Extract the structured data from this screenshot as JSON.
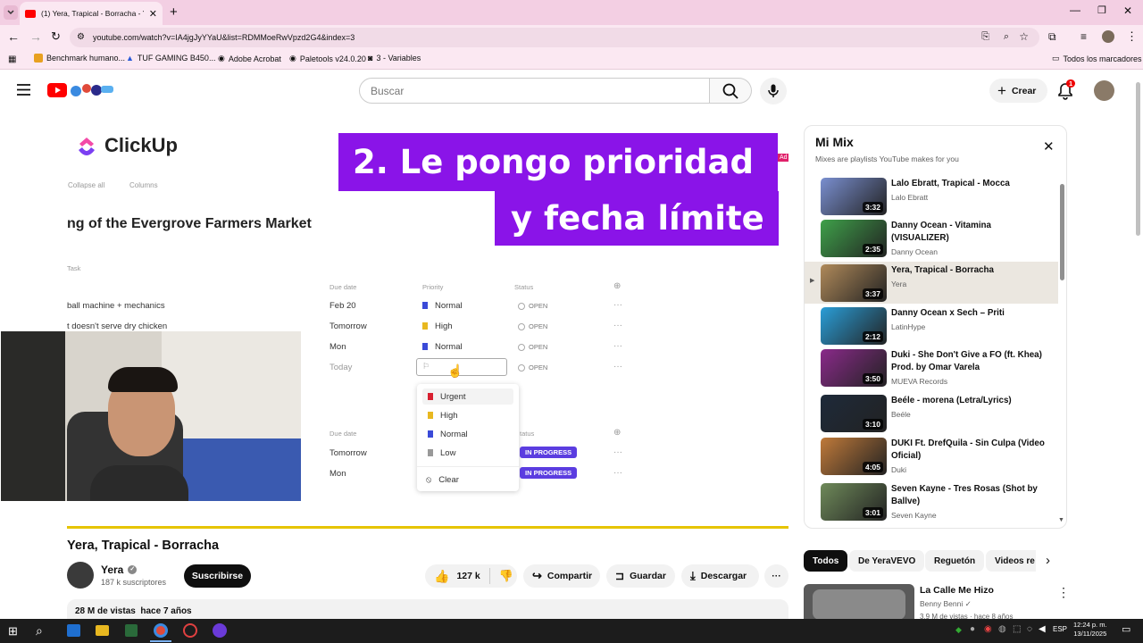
{
  "browser": {
    "tab_title": "(1) Yera, Trapical - Borracha - Yo",
    "url": "youtube.com/watch?v=IA4jgJyYYaU&list=RDMMoeRwVpzd2G4&index=3",
    "bookmarks": [
      "Benchmark humano...",
      "TUF GAMING B450...",
      "Adobe Acrobat",
      "Paletools v24.0.20",
      "3 - Variables"
    ],
    "all_bookmarks": "Todos los marcadores"
  },
  "yt": {
    "search_placeholder": "Buscar",
    "create_label": "Crear",
    "notif_count": "1"
  },
  "video_overlay": {
    "caption_line1": "2. Le pongo prioridad",
    "caption_line2": "y fecha límite",
    "clickup_logo": "ClickUp",
    "toolbar": [
      "Collapse all",
      "Columns"
    ],
    "project_title": "ng of the Evergrove Farmers Market",
    "task_header": "Task",
    "columns": [
      "Due date",
      "Priority",
      "Status"
    ],
    "tasks": [
      {
        "name": "ball machine + mechanics",
        "due": "Feb 20",
        "priority": "Normal",
        "status": "OPEN"
      },
      {
        "name": "t doesn't serve dry chicken",
        "due": "Tomorrow",
        "priority": "High",
        "status": "OPEN"
      },
      {
        "name": "",
        "due": "Mon",
        "priority": "Normal",
        "status": "OPEN"
      },
      {
        "name": "",
        "due": "Today",
        "priority": "",
        "status": "OPEN"
      }
    ],
    "priority_menu": [
      "Urgent",
      "High",
      "Normal",
      "Low",
      "Clear"
    ],
    "group2_columns": [
      "Due date",
      "tatus"
    ],
    "group2": [
      {
        "due": "Tomorrow",
        "status": "IN PROGRESS"
      },
      {
        "due": "Mon",
        "status": "IN PROGRESS"
      }
    ],
    "ad_badge": "Ad"
  },
  "video": {
    "title": "Yera, Trapical - Borracha",
    "channel": "Yera",
    "subscribers": "187 k suscriptores",
    "subscribe_label": "Suscribirse",
    "likes": "127 k",
    "share_label": "Compartir",
    "save_label": "Guardar",
    "download_label": "Descargar",
    "views_line": "28 M de vistas  hace 7 años"
  },
  "mix": {
    "title": "Mi Mix",
    "subtitle": "Mixes are playlists YouTube makes for you",
    "items": [
      {
        "title": "Lalo Ebratt, Trapical - Mocca",
        "channel": "Lalo Ebratt",
        "duration": "3:32",
        "color": "#7a8fd0"
      },
      {
        "title": "Danny Ocean - Vitamina (VISUALIZER)",
        "channel": "Danny Ocean",
        "duration": "2:35",
        "color": "#3fa14a"
      },
      {
        "title": "Yera, Trapical - Borracha",
        "channel": "Yera",
        "duration": "3:37",
        "color": "#b08a5a"
      },
      {
        "title": "Danny Ocean x Sech – Priti",
        "channel": "LatinHype",
        "duration": "2:12",
        "color": "#2a9ed8"
      },
      {
        "title": "Duki - She Don't Give a FO (ft. Khea) Prod. by Omar Varela",
        "channel": "MUEVA Records",
        "duration": "3:50",
        "color": "#8a2a8a"
      },
      {
        "title": "Beéle - morena (Letra/Lyrics)",
        "channel": "Beéle",
        "duration": "3:10",
        "color": "#1e2a3a"
      },
      {
        "title": "DUKI Ft. DrefQuila - Sin Culpa (Video Oficial)",
        "channel": "Duki",
        "duration": "4:05",
        "color": "#c07a3a"
      },
      {
        "title": "Seven Kayne - Tres Rosas (Shot by Ballve)",
        "channel": "Seven Kayne",
        "duration": "3:01",
        "color": "#6f8a5a"
      }
    ]
  },
  "chips": [
    "Todos",
    "De YeraVEVO",
    "Reguetón",
    "Videos re"
  ],
  "recommended": {
    "title": "La Calle Me Hizo",
    "channel": "Benny Benni",
    "meta": "3,9 M de vistas · hace 8 años"
  },
  "taskbar": {
    "lang": "ESP",
    "time": "12:24 p. m.",
    "date": "13/11/2025"
  }
}
